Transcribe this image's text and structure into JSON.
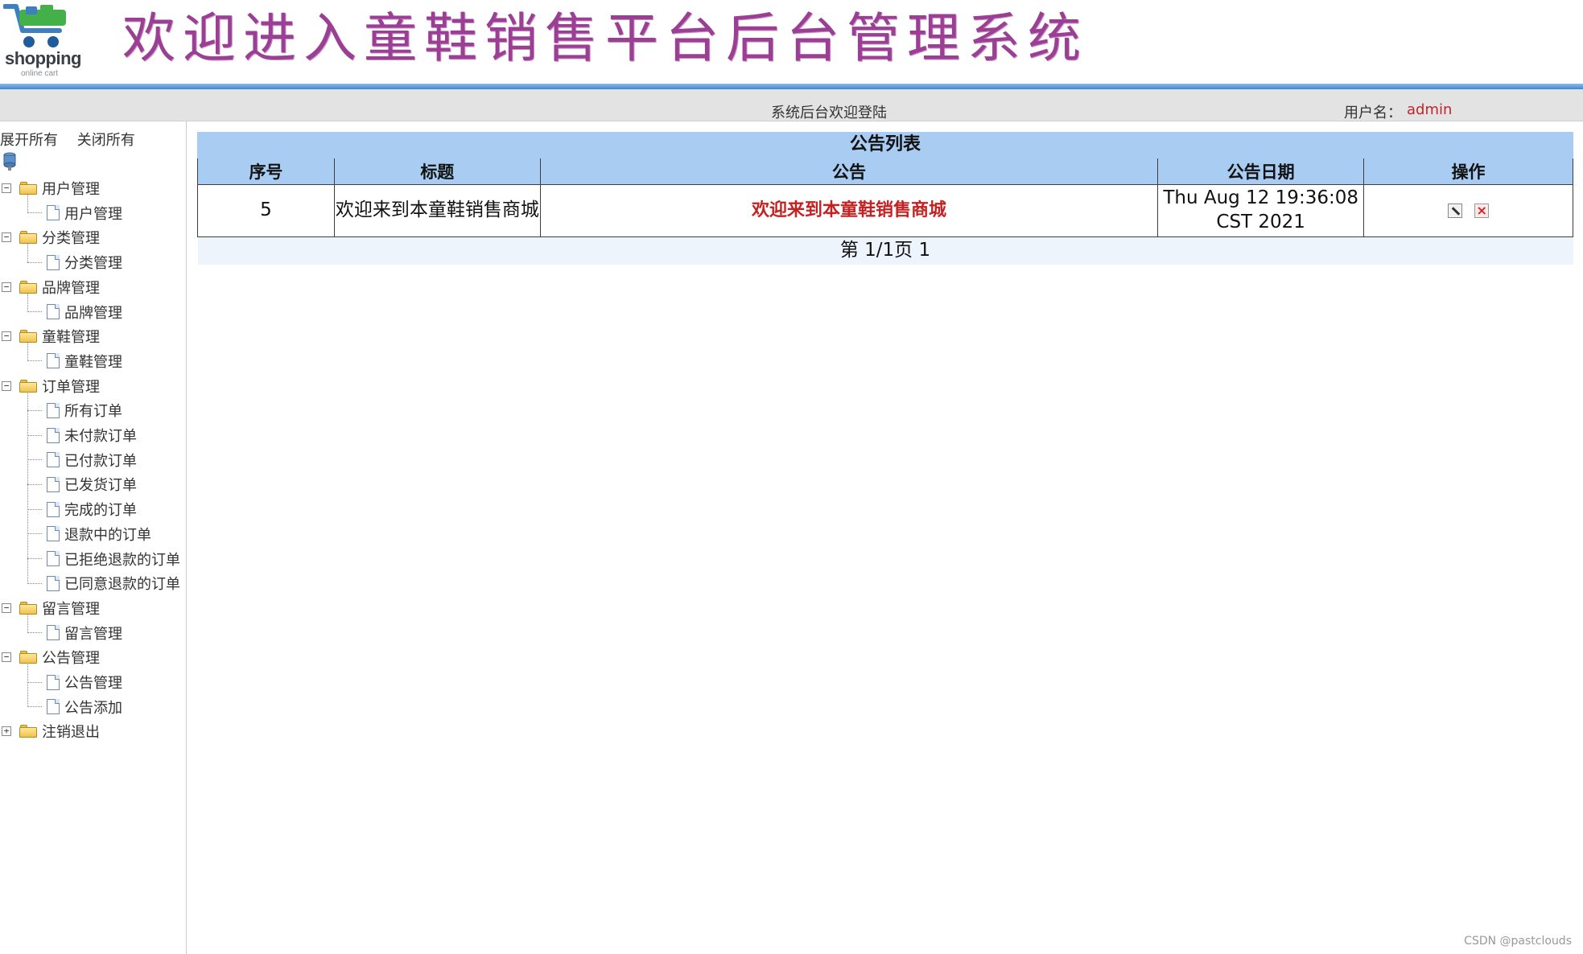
{
  "header": {
    "logo_text": "shopping",
    "logo_subtext": "online cart",
    "title": "欢迎进入童鞋销售平台后台管理系统"
  },
  "statusbar": {
    "welcome": "系统后台欢迎登陆",
    "user_label": "用户名：",
    "user_name": "admin"
  },
  "sidebar": {
    "expand_all": "展开所有",
    "collapse_all": "关闭所有",
    "groups": [
      {
        "label": "用户管理",
        "children": [
          "用户管理"
        ]
      },
      {
        "label": "分类管理",
        "children": [
          "分类管理"
        ]
      },
      {
        "label": "品牌管理",
        "children": [
          "品牌管理"
        ]
      },
      {
        "label": "童鞋管理",
        "children": [
          "童鞋管理"
        ]
      },
      {
        "label": "订单管理",
        "children": [
          "所有订单",
          "未付款订单",
          "已付款订单",
          "已发货订单",
          "完成的订单",
          "退款中的订单",
          "已拒绝退款的订单",
          "已同意退款的订单"
        ]
      },
      {
        "label": "留言管理",
        "children": [
          "留言管理"
        ]
      },
      {
        "label": "公告管理",
        "children": [
          "公告管理",
          "公告添加"
        ]
      },
      {
        "label": "注销退出",
        "children": []
      }
    ]
  },
  "notice_list": {
    "caption": "公告列表",
    "columns": [
      "序号",
      "标题",
      "公告",
      "公告日期",
      "操作"
    ],
    "rows": [
      {
        "id": "5",
        "title": "欢迎来到本童鞋销售商城",
        "content": "欢迎来到本童鞋销售商城",
        "date": "Thu Aug 12 19:36:08 CST 2021"
      }
    ],
    "pager": "第 1/1页 1"
  },
  "watermark": "CSDN @pastclouds",
  "colors": {
    "title_purple": "#9a3f94",
    "table_header_bg": "#a9cdf2",
    "notice_red": "#c42222",
    "user_red": "#c0262b"
  }
}
